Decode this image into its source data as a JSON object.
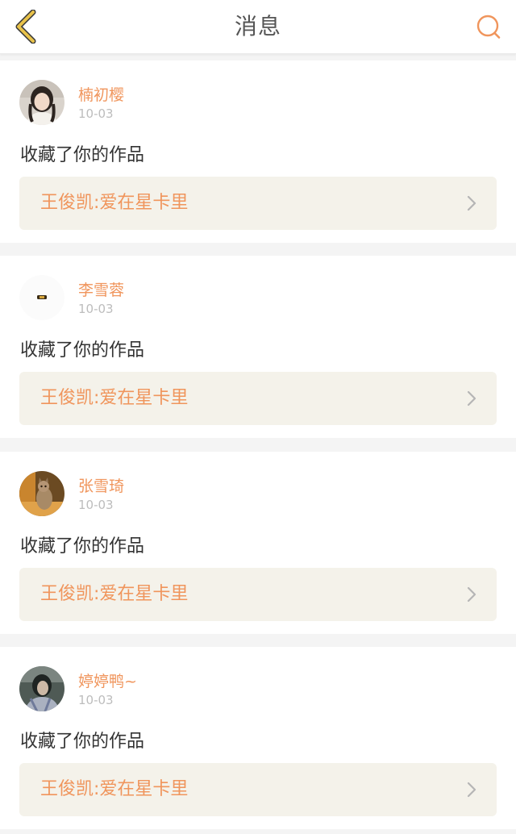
{
  "header": {
    "title": "消息",
    "back_icon": "chevron-left-icon",
    "search_icon": "search-icon",
    "accent_color": "#f0955c",
    "back_color": "#e8c24a"
  },
  "messages": [
    {
      "username": "楠初樱",
      "date": "10-03",
      "action": "收藏了你的作品",
      "work_title": "王俊凯:爱在星卡里"
    },
    {
      "username": "李雪蓉",
      "date": "10-03",
      "action": "收藏了你的作品",
      "work_title": "王俊凯:爱在星卡里"
    },
    {
      "username": "张雪琦",
      "date": "10-03",
      "action": "收藏了你的作品",
      "work_title": "王俊凯:爱在星卡里"
    },
    {
      "username": "婷婷鸭~",
      "date": "10-03",
      "action": "收藏了你的作品",
      "work_title": "王俊凯:爱在星卡里"
    }
  ]
}
